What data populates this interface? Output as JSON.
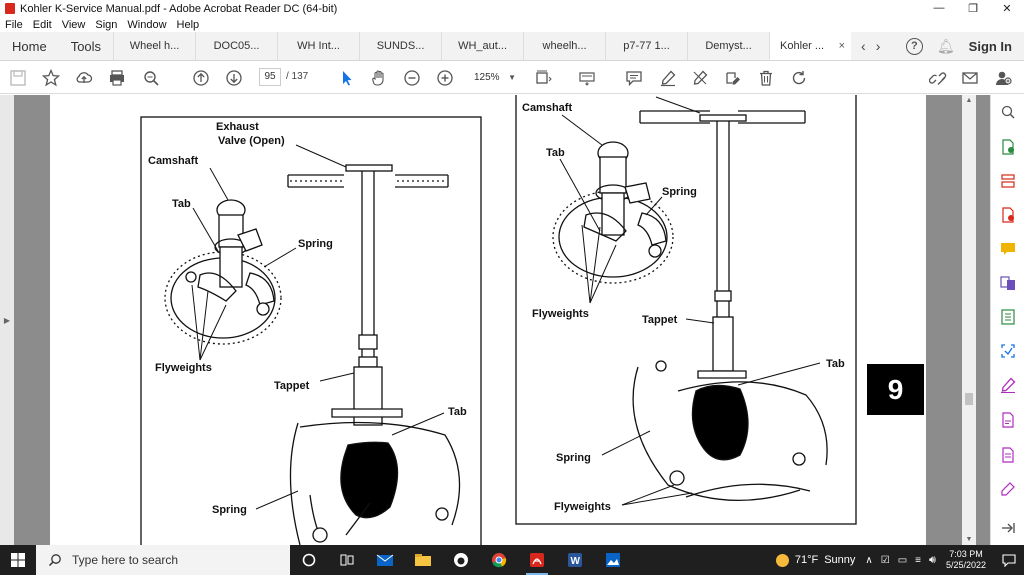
{
  "window": {
    "title": "Kohler K-Service Manual.pdf - Adobe Acrobat Reader DC (64-bit)",
    "controls": [
      "—",
      "❐",
      "✕"
    ]
  },
  "menu": [
    "File",
    "Edit",
    "View",
    "Sign",
    "Window",
    "Help"
  ],
  "tabs": {
    "home": "Home",
    "tools": "Tools",
    "docs": [
      "Wheel h...",
      "DOC05...",
      "WH Int...",
      "SUNDS...",
      "WH_aut...",
      "wheelh...",
      "p7-77 1...",
      "Demyst...",
      "Kohler ..."
    ],
    "active_index": 8,
    "close": "×",
    "help": "?",
    "signin": "Sign In"
  },
  "toolbar": {
    "page_current": "95",
    "page_total": "/  137",
    "zoom": "125%"
  },
  "document": {
    "left_figure": {
      "labels": [
        "Exhaust",
        "Valve (Open)",
        "Camshaft",
        "Tab",
        "Spring",
        "Flyweights",
        "Tappet",
        "Tab",
        "Spring"
      ]
    },
    "right_figure": {
      "labels": [
        "Camshaft",
        "Tab",
        "Spring",
        "Flyweights",
        "Tappet",
        "Tab",
        "Spring",
        "Flyweights"
      ]
    },
    "section_number": "9"
  },
  "taskbar": {
    "search_placeholder": "Type here to search",
    "weather_temp": "71°F",
    "weather_text": "Sunny",
    "time": "7:03 PM",
    "date": "5/25/2022"
  },
  "colors": {
    "acrobat_red": "#d8271c",
    "taskbar": "#1f1f1f",
    "doc_bg": "#8c8c8c"
  }
}
